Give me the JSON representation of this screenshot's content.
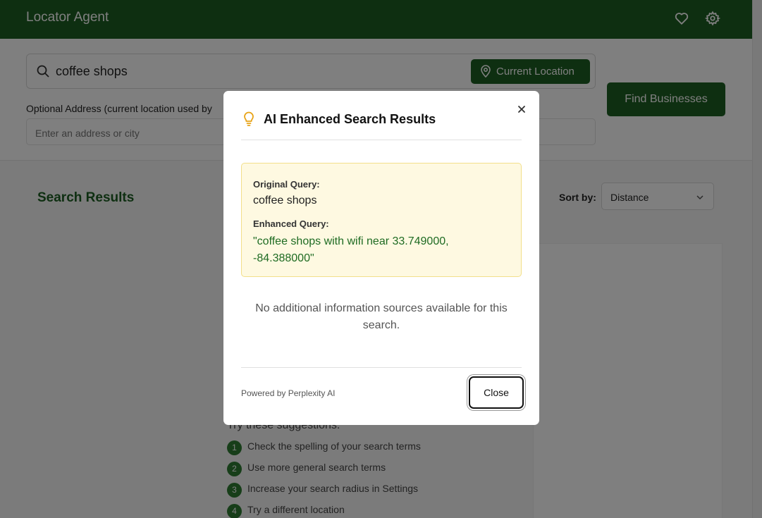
{
  "header": {
    "app_title": "Locator Agent",
    "icons": [
      "heart-icon",
      "gear-icon"
    ]
  },
  "search": {
    "query_value": "coffee shops",
    "current_location_label": "Current Location",
    "address_label": "Optional Address (current location used by",
    "address_placeholder": "Enter an address or city",
    "find_button_label": "Find Businesses"
  },
  "results": {
    "title": "Search Results",
    "sort_label": "Sort by:",
    "sort_value": "Distance"
  },
  "suggestions": {
    "title": "Try these suggestions:",
    "items": [
      {
        "num": "1",
        "text": "Check the spelling of your search terms"
      },
      {
        "num": "2",
        "text": "Use more general search terms"
      },
      {
        "num": "3",
        "text": "Increase your search radius in Settings"
      },
      {
        "num": "4",
        "text": "Try a different location"
      }
    ]
  },
  "modal": {
    "title": "AI Enhanced Search Results",
    "original_label": "Original Query:",
    "original_value": "coffee shops",
    "enhanced_label": "Enhanced Query:",
    "enhanced_value": "\"coffee shops with wifi near 33.749000, -84.388000\"",
    "no_sources_text": "No additional information sources available for this search.",
    "powered_by": "Powered by Perplexity AI",
    "close_label": "Close"
  },
  "colors": {
    "brand_green": "#1d5e23",
    "enhanced_text": "#1e6b22",
    "query_box_bg": "#fef9e1",
    "bulb": "#e8a317"
  }
}
